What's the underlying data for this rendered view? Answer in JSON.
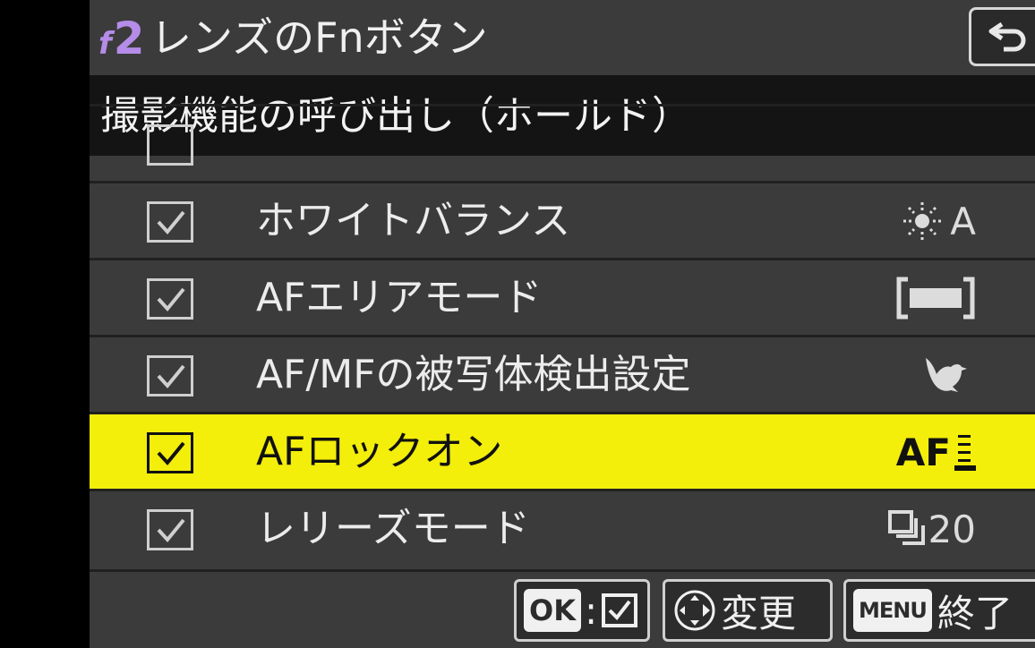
{
  "header": {
    "menu_code_letter": "f",
    "menu_code_number": "2",
    "title": "レンズのFnボタン"
  },
  "subtitle": "撮影機能の呼び出し（ホールド）",
  "list": {
    "rows": [
      {
        "label": "ホワイトバランス",
        "checked": true,
        "icon_name": "sun-icon",
        "value_text": "A",
        "selected": false
      },
      {
        "label": "AFエリアモード",
        "checked": true,
        "icon_name": "wide-area-bracket-icon",
        "value_text": "",
        "selected": false
      },
      {
        "label": "AF/MFの被写体検出設定",
        "checked": true,
        "icon_name": "bird-icon",
        "value_text": "",
        "selected": false
      },
      {
        "label": "AFロックオン",
        "checked": true,
        "icon_name": "af-lockon-icon",
        "value_text": "AF",
        "selected": true
      },
      {
        "label": "レリーズモード",
        "checked": true,
        "icon_name": "release-mode-icon",
        "value_text": "20",
        "selected": false
      }
    ]
  },
  "footer": {
    "ok_key": "OK",
    "ok_colon": ":",
    "change_label": "変更",
    "menu_key": "MENU",
    "exit_label": "終了"
  },
  "colors": {
    "highlight": "#f3ee0a",
    "menu_code": "#b58ce8",
    "background": "#3b3b3b",
    "band": "#141414"
  }
}
